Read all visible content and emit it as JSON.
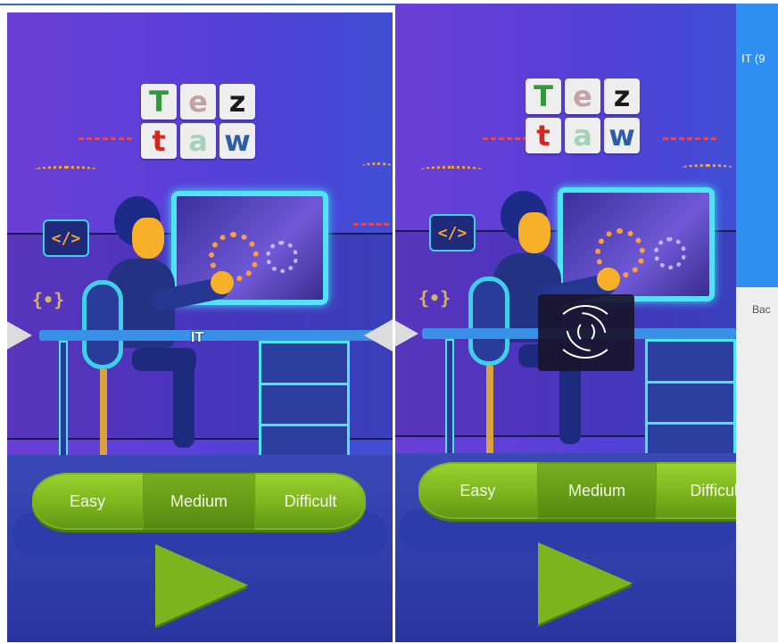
{
  "logo": {
    "tiles": [
      {
        "letter": "T",
        "color": "#2e9a3a"
      },
      {
        "letter": "e",
        "color": "#c2a3a3"
      },
      {
        "letter": "z",
        "color": "#1a1a1a"
      },
      {
        "letter": "t",
        "color": "#d7261e"
      },
      {
        "letter": "a",
        "color": "#a6d3b7"
      },
      {
        "letter": "w",
        "color": "#2f5ea8"
      }
    ]
  },
  "left_screen": {
    "category_label": "IT",
    "difficulty": {
      "options": [
        "Easy",
        "Medium",
        "Difficult"
      ],
      "selected": "Medium"
    }
  },
  "right_screen": {
    "difficulty": {
      "options": [
        "Easy",
        "Medium",
        "Difficult"
      ],
      "selected": "Medium"
    },
    "loading": true
  },
  "side_panel": {
    "header_text": "IT (9",
    "back_text": "Bac"
  },
  "colors": {
    "accent_green": "#8cc63f",
    "panel_blue": "#2f8ff0",
    "background_purple": "#5a3fd8"
  },
  "icons": {
    "prev": "chevron-left-icon",
    "next": "chevron-right-icon",
    "play": "play-icon",
    "loading": "loading-spinner-icon"
  }
}
